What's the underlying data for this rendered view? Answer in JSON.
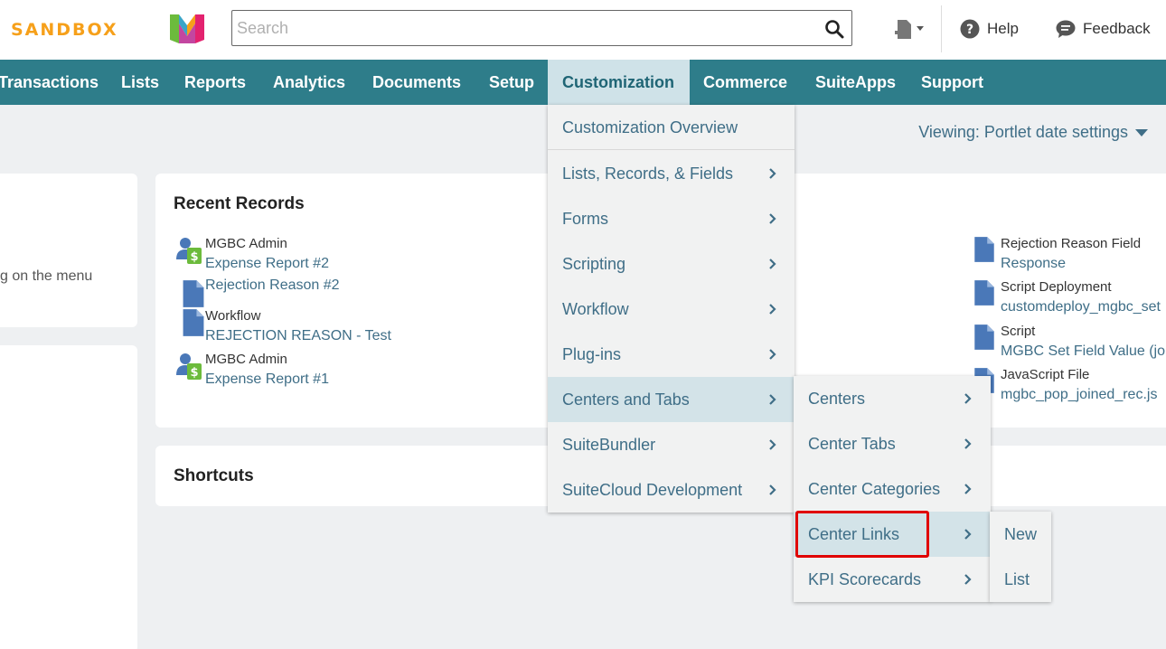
{
  "header": {
    "brand": "SANDBOX",
    "search_placeholder": "Search",
    "help_label": "Help",
    "feedback_label": "Feedback",
    "logo_colors": [
      "#6cbb3c",
      "#e3226f",
      "#f6a01a",
      "#3aa5c8"
    ]
  },
  "nav": {
    "items": [
      "Transactions",
      "Lists",
      "Reports",
      "Analytics",
      "Documents",
      "Setup",
      "Customization",
      "Commerce",
      "SuiteApps",
      "Support"
    ],
    "active": "Customization"
  },
  "viewing": "Viewing: Portlet date settings",
  "left_card_text": "g on the menu",
  "recent_records": {
    "title": "Recent Records",
    "left": [
      {
        "type": "expense",
        "line1": "MGBC Admin",
        "line2": "Expense Report #2"
      },
      {
        "type": "doc",
        "line1": "",
        "line2": "Rejection Reason #2"
      },
      {
        "type": "doc",
        "line1": "Workflow",
        "line2": "REJECTION REASON - Test"
      },
      {
        "type": "expense",
        "line1": "MGBC Admin",
        "line2": "Expense Report #1"
      }
    ],
    "right": [
      {
        "line1": "Rejection Reason Field",
        "line2": "Response"
      },
      {
        "line1": "Script Deployment",
        "line2": "customdeploy_mgbc_set"
      },
      {
        "line1": "Script",
        "line2": "MGBC Set Field Value (jo"
      },
      {
        "line1": "JavaScript File",
        "line2": "mgbc_pop_joined_rec.js"
      }
    ]
  },
  "shortcuts": {
    "title": "Shortcuts"
  },
  "customization_menu": {
    "items": [
      "Customization Overview",
      "Lists, Records, & Fields",
      "Forms",
      "Scripting",
      "Workflow",
      "Plug-ins",
      "Centers and Tabs",
      "SuiteBundler",
      "SuiteCloud Development"
    ],
    "highlighted": "Centers and Tabs"
  },
  "centers_menu": {
    "items": [
      "Centers",
      "Center Tabs",
      "Center Categories",
      "Center Links",
      "KPI Scorecards"
    ],
    "highlighted": "Center Links"
  },
  "links_menu": {
    "items": [
      "New",
      "List"
    ]
  }
}
